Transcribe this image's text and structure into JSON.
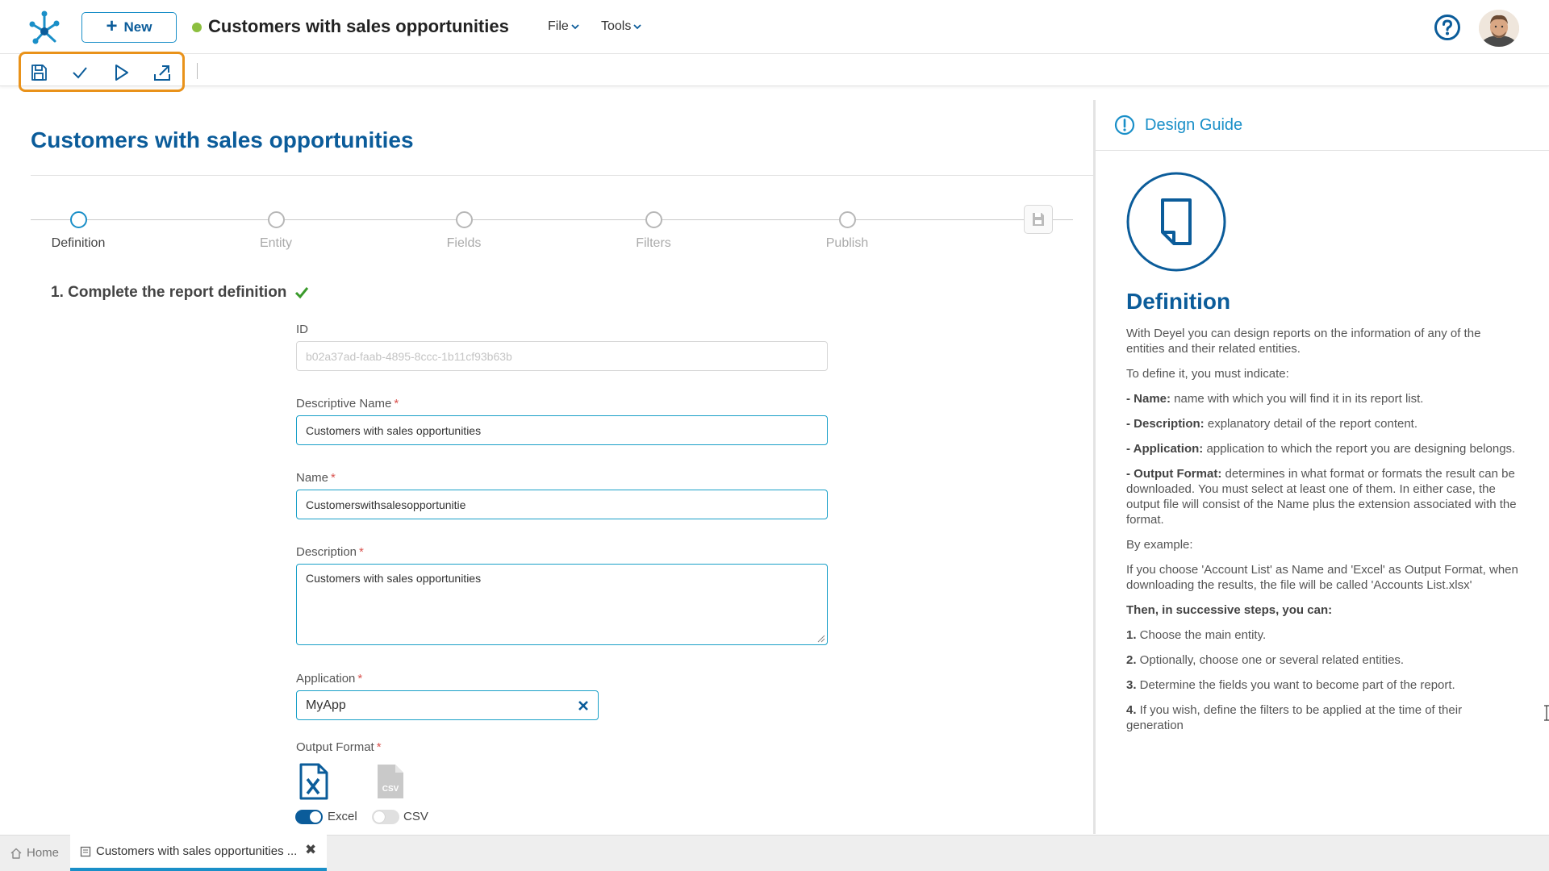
{
  "topbar": {
    "new_label": "New",
    "doc_title": "Customers with sales opportunities",
    "menus": [
      "File",
      "Tools"
    ],
    "status_color": "#8cbf3f"
  },
  "icons": {
    "logo": "deyel-logo-icon",
    "help": "help-circle-icon",
    "toolbar": [
      "save-icon",
      "check-icon",
      "play-icon",
      "export-icon"
    ]
  },
  "page": {
    "title": "Customers with sales opportunities"
  },
  "stepper": {
    "steps": [
      "Definition",
      "Entity",
      "Fields",
      "Filters",
      "Publish"
    ],
    "active_index": 0
  },
  "form": {
    "heading": "1. Complete the report definition",
    "id_label": "ID",
    "id_value": "b02a37ad-faab-4895-8ccc-1b11cf93b63b",
    "descriptive_name_label": "Descriptive Name",
    "descriptive_name_value": "Customers with sales opportunities",
    "name_label": "Name",
    "name_value": "Customerswithsalesopportunitie",
    "description_label": "Description",
    "description_value": "Customers with sales opportunities",
    "application_label": "Application",
    "application_value": "MyApp",
    "output_format_label": "Output Format",
    "required_mark": "*",
    "formats": [
      {
        "label": "Excel",
        "enabled": true
      },
      {
        "label": "CSV",
        "enabled": false
      }
    ]
  },
  "guide": {
    "header": "Design Guide",
    "title": "Definition",
    "p1": "With Deyel you can design reports on the information of any of the entities and their related entities.",
    "p2": "To define it, you must indicate:",
    "name_bold": "- Name:",
    "name_text": " name with which you will find it in its report list.",
    "desc_bold": "- Description:",
    "desc_text": " explanatory detail of the report content.",
    "app_bold": "- Application:",
    "app_text": " application to which the report you are designing belongs.",
    "out_bold": "- Output Format:",
    "out_text": " determines in what format or formats the result can be downloaded. You must select at least one of them. In either case, the output file will consist of the Name plus the extension associated with the format.",
    "p_example": "By example:",
    "p_example_text": "If you choose 'Account List' as Name and 'Excel' as Output Format, when downloading the results, the file will be called 'Accounts List.xlsx'",
    "then_bold": "Then, in successive steps, you can:",
    "s1_num": "1.",
    "s1_text": " Choose the main entity.",
    "s2_num": "2.",
    "s2_text": " Optionally, choose one or several related entities.",
    "s3_num": "3.",
    "s3_text": " Determine the fields you want to become part of the report.",
    "s4_num": "4.",
    "s4_text": " If you wish, define the filters to be applied at the time of their generation"
  },
  "tabs": {
    "home": "Home",
    "doc": "Customers with sales opportunities ...",
    "close": "✖"
  },
  "colors": {
    "accent": "#1a8fc8",
    "brand": "#0b5c9a",
    "highlight": "#e9921a"
  }
}
